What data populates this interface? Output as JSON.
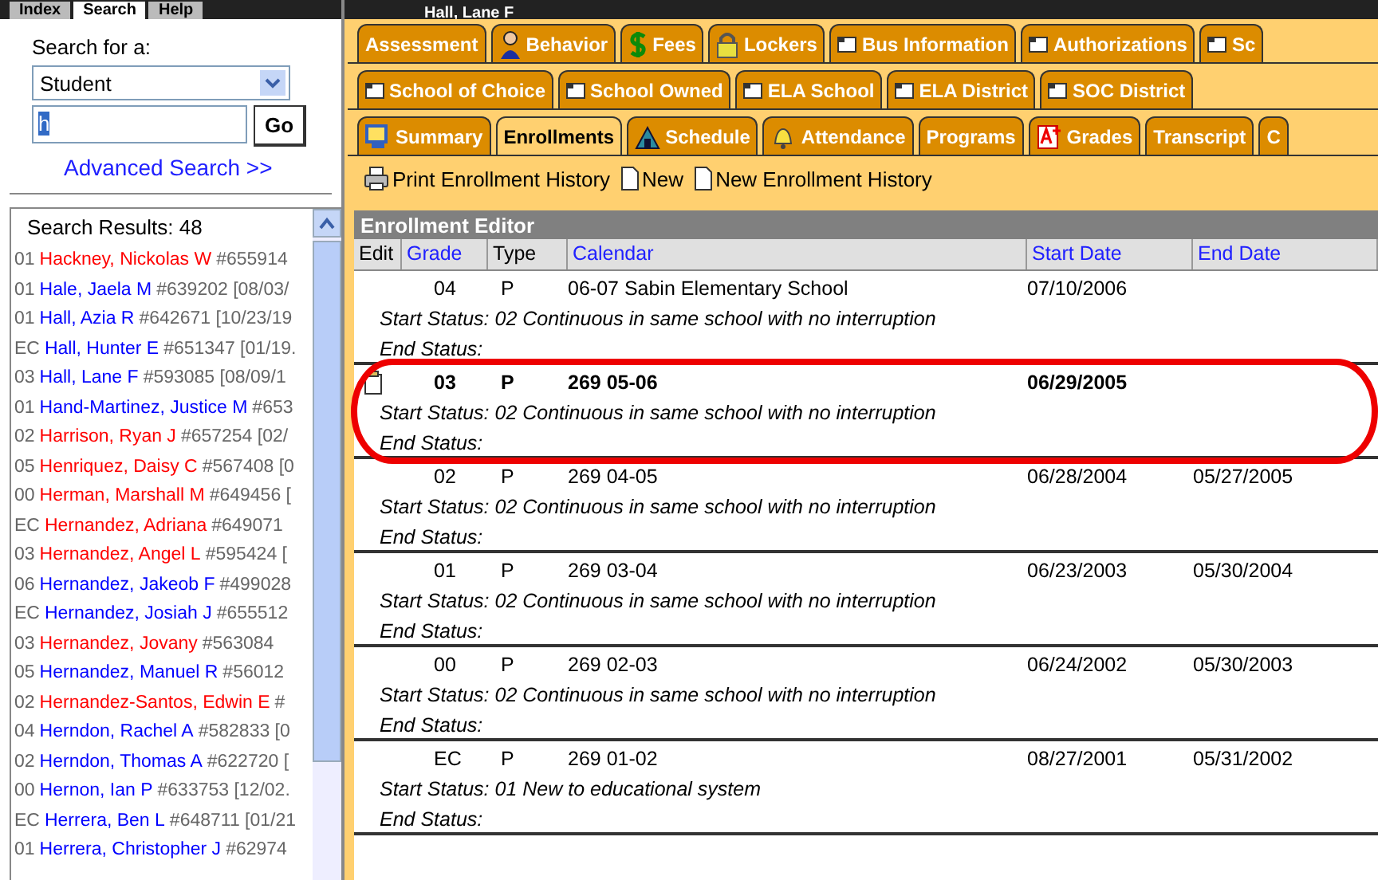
{
  "header": {
    "title": "Hall, Lane F"
  },
  "left_tabs": [
    {
      "label": "Index",
      "selected": false
    },
    {
      "label": "Search",
      "selected": true
    },
    {
      "label": "Help",
      "selected": false
    }
  ],
  "search": {
    "label": "Search for a:",
    "type_value": "Student",
    "query": "h",
    "go": "Go",
    "advanced": "Advanced Search >>"
  },
  "results": {
    "title": "Search Results: 48",
    "students": [
      {
        "grade": "01",
        "name": "Hackney, Nickolas W",
        "info": "#655914",
        "color": "#ff0000"
      },
      {
        "grade": "01",
        "name": "Hale, Jaela M",
        "info": "#639202 [08/03/",
        "color": "#0000ff"
      },
      {
        "grade": "01",
        "name": "Hall, Azia R",
        "info": "#642671 [10/23/19",
        "color": "#0000ff"
      },
      {
        "grade": "EC",
        "name": "Hall, Hunter E",
        "info": "#651347 [01/19.",
        "color": "#0000ff"
      },
      {
        "grade": "03",
        "name": "Hall, Lane F",
        "info": "#593085 [08/09/1",
        "color": "#0000ff"
      },
      {
        "grade": "01",
        "name": "Hand-Martinez, Justice M",
        "info": "#653",
        "color": "#0000ff"
      },
      {
        "grade": "02",
        "name": "Harrison, Ryan J",
        "info": "#657254 [02/",
        "color": "#ff0000"
      },
      {
        "grade": "05",
        "name": "Henriquez, Daisy C",
        "info": "#567408 [0",
        "color": "#ff0000"
      },
      {
        "grade": "00",
        "name": "Herman, Marshall M",
        "info": "#649456 [",
        "color": "#ff0000"
      },
      {
        "grade": "EC",
        "name": "Hernandez, Adriana",
        "info": "#649071",
        "color": "#ff0000"
      },
      {
        "grade": "03",
        "name": "Hernandez, Angel L",
        "info": "#595424 [",
        "color": "#ff0000"
      },
      {
        "grade": "06",
        "name": "Hernandez, Jakeob F",
        "info": "#499028",
        "color": "#0000ff"
      },
      {
        "grade": "EC",
        "name": "Hernandez, Josiah J",
        "info": "#655512",
        "color": "#0000ff"
      },
      {
        "grade": "03",
        "name": "Hernandez, Jovany",
        "info": "#563084",
        "color": "#ff0000"
      },
      {
        "grade": "05",
        "name": "Hernandez, Manuel R",
        "info": "#56012",
        "color": "#0000ff"
      },
      {
        "grade": "02",
        "name": "Hernandez-Santos, Edwin E",
        "info": "#",
        "color": "#ff0000"
      },
      {
        "grade": "04",
        "name": "Herndon, Rachel A",
        "info": "#582833 [0",
        "color": "#0000ff"
      },
      {
        "grade": "02",
        "name": "Herndon, Thomas A",
        "info": "#622720 [",
        "color": "#0000ff"
      },
      {
        "grade": "00",
        "name": "Hernon, Ian P",
        "info": "#633753 [12/02.",
        "color": "#0000ff"
      },
      {
        "grade": "EC",
        "name": "Herrera, Ben L",
        "info": "#648711 [01/21",
        "color": "#0000ff"
      },
      {
        "grade": "01",
        "name": "Herrera, Christopher J",
        "info": "#62974",
        "color": "#0000ff"
      }
    ]
  },
  "tab_rows": [
    [
      {
        "label": "Assessment",
        "kind": "none",
        "selected": false
      },
      {
        "label": "Behavior",
        "kind": "person",
        "selected": false
      },
      {
        "label": "Fees",
        "kind": "dollar",
        "selected": false
      },
      {
        "label": "Lockers",
        "kind": "lock",
        "selected": false
      },
      {
        "label": "Bus Information",
        "kind": "doc",
        "selected": false
      },
      {
        "label": "Authorizations",
        "kind": "doc",
        "selected": false
      },
      {
        "label": "Sc",
        "kind": "doc",
        "selected": false
      }
    ],
    [
      {
        "label": "School of Choice",
        "kind": "doc",
        "selected": false
      },
      {
        "label": "School Owned",
        "kind": "doc",
        "selected": false
      },
      {
        "label": "ELA School",
        "kind": "doc",
        "selected": false
      },
      {
        "label": "ELA District",
        "kind": "doc",
        "selected": false
      },
      {
        "label": "SOC District",
        "kind": "doc",
        "selected": false
      }
    ],
    [
      {
        "label": "Summary",
        "kind": "monitor",
        "selected": false
      },
      {
        "label": "Enrollments",
        "kind": "none",
        "selected": true
      },
      {
        "label": "Schedule",
        "kind": "building",
        "selected": false
      },
      {
        "label": "Attendance",
        "kind": "bell",
        "selected": false
      },
      {
        "label": "Programs",
        "kind": "none",
        "selected": false
      },
      {
        "label": "Grades",
        "kind": "grades",
        "selected": false
      },
      {
        "label": "Transcript",
        "kind": "none",
        "selected": false
      },
      {
        "label": "C",
        "kind": "none",
        "selected": false
      }
    ]
  ],
  "toolbar": [
    {
      "label": "Print Enrollment History",
      "kind": "print"
    },
    {
      "label": "New",
      "kind": "page"
    },
    {
      "label": "New Enrollment History",
      "kind": "page"
    }
  ],
  "editor": {
    "title": "Enrollment Editor",
    "columns": [
      "Edit",
      "Grade",
      "Type",
      "Calendar",
      "Start Date",
      "End Date"
    ],
    "rows": [
      {
        "grade": "04",
        "type": "P",
        "calendar": "06-07 Sabin Elementary School",
        "start_date": "07/10/2006",
        "start_status": "Start Status: 02 Continuous in same school with no interruption",
        "end_status": "End Status:",
        "selected": false
      },
      {
        "grade": "03",
        "type": "P",
        "calendar": "269 05-06",
        "start_date": "06/29/2005",
        "start_status": "Start Status: 02 Continuous in same school with no interruption",
        "end_status": "End Status:",
        "selected": true
      },
      {
        "grade": "02",
        "type": "P",
        "calendar": "269 04-05",
        "start_date": "06/28/2004",
        "end_date": "05/27/2005",
        "start_status": "Start Status: 02 Continuous in same school with no interruption",
        "end_status": "End Status:",
        "selected": false
      },
      {
        "grade": "01",
        "type": "P",
        "calendar": "269 03-04",
        "start_date": "06/23/2003",
        "end_date": "05/30/2004",
        "start_status": "Start Status: 02 Continuous in same school with no interruption",
        "end_status": "End Status:",
        "selected": false
      },
      {
        "grade": "00",
        "type": "P",
        "calendar": "269 02-03",
        "start_date": "06/24/2002",
        "end_date": "05/30/2003",
        "start_status": "Start Status: 02 Continuous in same school with no interruption",
        "end_status": "End Status:",
        "selected": false
      },
      {
        "grade": "EC",
        "type": "P",
        "calendar": "269 01-02",
        "start_date": "08/27/2001",
        "end_date": "05/31/2002",
        "start_status": "Start Status: 01 New to educational system",
        "end_status": "End Status:",
        "selected": false
      }
    ]
  }
}
